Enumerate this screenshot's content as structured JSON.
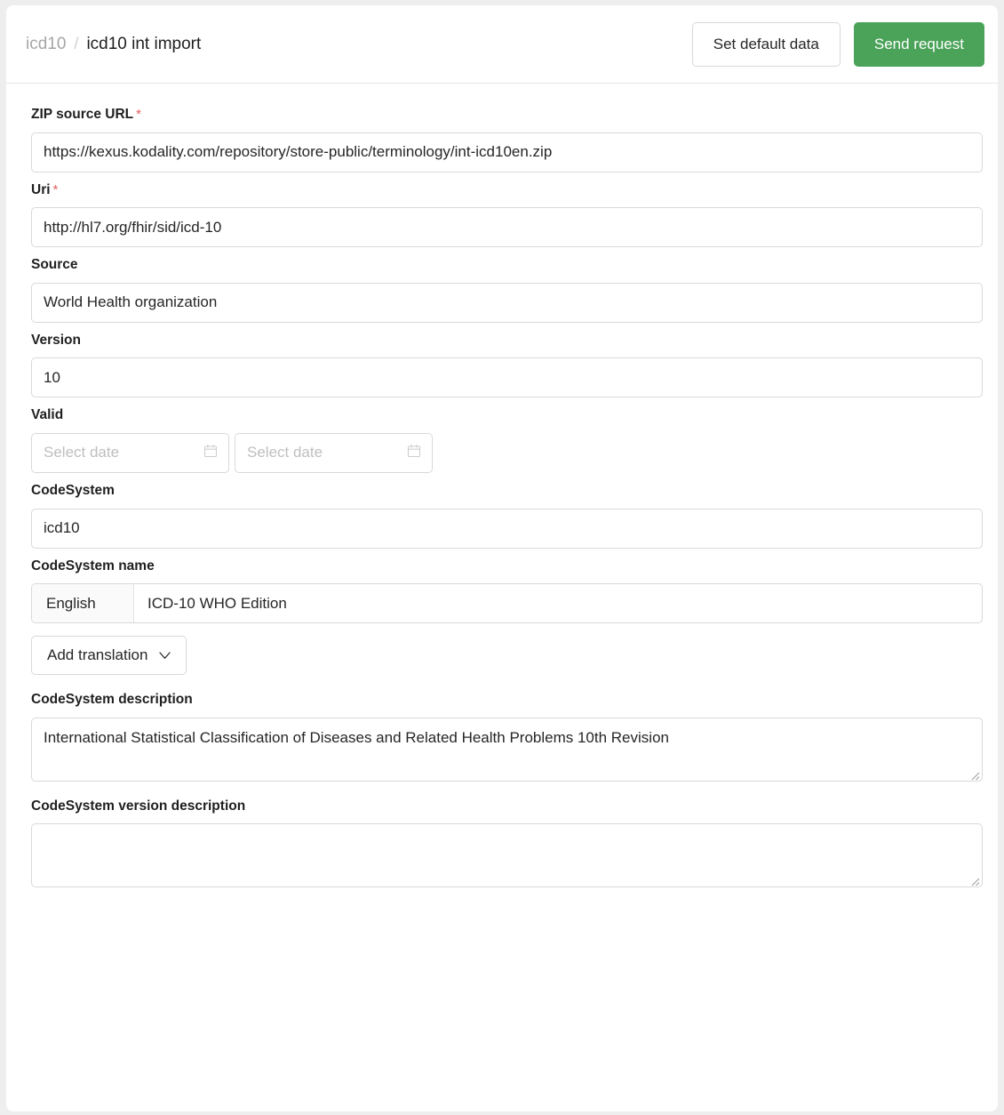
{
  "header": {
    "breadcrumb": {
      "parent": "icd10",
      "separator": "/",
      "current": "icd10 int import"
    },
    "set_default_data_label": "Set default data",
    "send_request_label": "Send request",
    "primary_color": "#4aa359"
  },
  "form": {
    "zip_source_url": {
      "label": "ZIP source URL",
      "required_marker": "*",
      "value": "https://kexus.kodality.com/repository/store-public/terminology/int-icd10en.zip"
    },
    "uri": {
      "label": "Uri",
      "required_marker": "*",
      "value": "http://hl7.org/fhir/sid/icd-10"
    },
    "source": {
      "label": "Source",
      "value": "World Health organization"
    },
    "version": {
      "label": "Version",
      "value": "10"
    },
    "valid": {
      "label": "Valid",
      "from_placeholder": "Select date",
      "to_placeholder": "Select date",
      "from_value": "",
      "to_value": ""
    },
    "codesystem": {
      "label": "CodeSystem",
      "value": "icd10"
    },
    "codesystem_name": {
      "label": "CodeSystem name",
      "language": "English",
      "value": "ICD-10 WHO Edition",
      "add_translation_label": "Add translation"
    },
    "codesystem_description": {
      "label": "CodeSystem description",
      "value": "International Statistical Classification of Diseases and Related Health Problems 10th Revision"
    },
    "codesystem_version_description": {
      "label": "CodeSystem version description",
      "value": ""
    }
  }
}
